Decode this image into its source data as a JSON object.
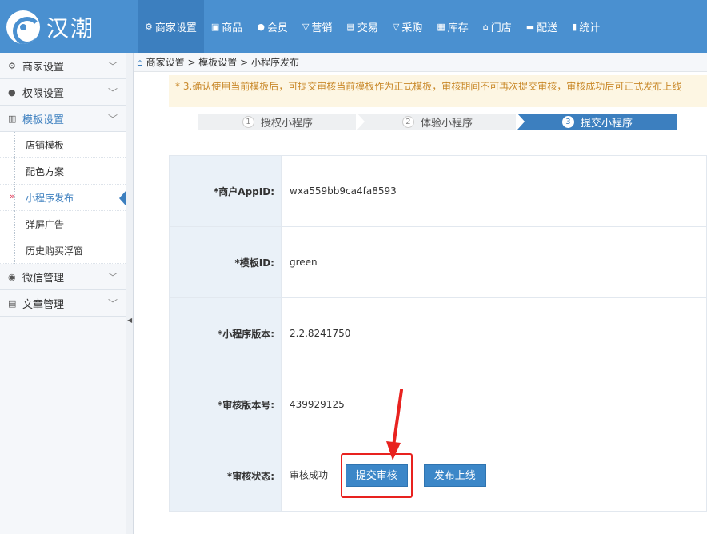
{
  "brand": {
    "name": "汉潮"
  },
  "nav": [
    {
      "label": "商家设置",
      "icon": "⚙"
    },
    {
      "label": "商品",
      "icon": "▣"
    },
    {
      "label": "会员",
      "icon": "●"
    },
    {
      "label": "营销",
      "icon": "▽"
    },
    {
      "label": "交易",
      "icon": "▤"
    },
    {
      "label": "采购",
      "icon": "▽"
    },
    {
      "label": "库存",
      "icon": "▦"
    },
    {
      "label": "门店",
      "icon": "⌂"
    },
    {
      "label": "配送",
      "icon": "▬"
    },
    {
      "label": "统计",
      "icon": "▮"
    }
  ],
  "sidebar": {
    "groups": [
      {
        "label": "商家设置",
        "icon": "⚙"
      },
      {
        "label": "权限设置",
        "icon": "●"
      },
      {
        "label": "模板设置",
        "icon": "▥"
      }
    ],
    "sub": [
      {
        "label": "店铺模板"
      },
      {
        "label": "配色方案"
      },
      {
        "label": "小程序发布"
      },
      {
        "label": "弹屏广告"
      },
      {
        "label": "历史购买浮窗"
      }
    ],
    "groups2": [
      {
        "label": "微信管理",
        "icon": "◉"
      },
      {
        "label": "文章管理",
        "icon": "▤"
      }
    ]
  },
  "breadcrumb": {
    "text": "商家设置 > 模板设置 > 小程序发布"
  },
  "notice": "* 3.确认使用当前模板后，可提交审核当前模板作为正式模板，审核期间不可再次提交审核，审核成功后可正式发布上线",
  "steps": [
    {
      "num": "1",
      "label": "授权小程序"
    },
    {
      "num": "2",
      "label": "体验小程序"
    },
    {
      "num": "3",
      "label": "提交小程序"
    }
  ],
  "form": {
    "appid_label": "*商户AppID:",
    "appid_value": "wxa559bb9ca4fa8593",
    "template_label": "*模板ID:",
    "template_value": "green",
    "version_label": "*小程序版本:",
    "version_value": "2.2.8241750",
    "audit_no_label": "*审核版本号:",
    "audit_no_value": "439929125",
    "status_label": "*审核状态:",
    "status_value": "审核成功",
    "submit_btn": "提交审核",
    "publish_btn": "发布上线"
  },
  "colors": {
    "header": "#4a90d0",
    "accent": "#3c7fbf",
    "annotation": "#e8221f",
    "notice_bg": "#fdf6e3"
  }
}
